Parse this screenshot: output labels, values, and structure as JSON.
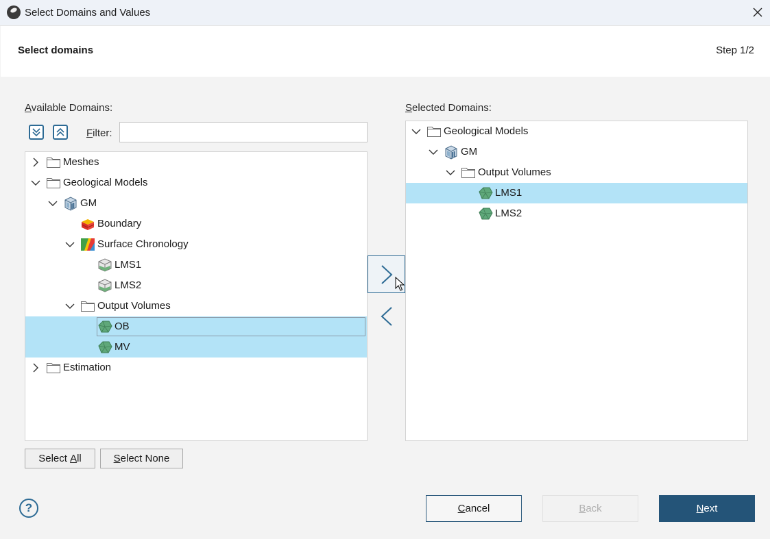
{
  "window": {
    "title": "Select Domains and Values"
  },
  "header": {
    "title": "Select domains",
    "step": "Step 1/2"
  },
  "available": {
    "label_prefix": "A",
    "label_rest": "vailable Domains:",
    "filter_label_prefix": "F",
    "filter_label_rest": "ilter:",
    "filter_value": "",
    "tree": [
      {
        "label": "Meshes",
        "depth": 0,
        "expander": "collapsed",
        "icon": "folder-icon",
        "selected": false
      },
      {
        "label": "Geological Models",
        "depth": 0,
        "expander": "expanded",
        "icon": "folder-icon",
        "selected": false
      },
      {
        "label": "GM",
        "depth": 1,
        "expander": "expanded",
        "icon": "geomodel-icon",
        "selected": false
      },
      {
        "label": "Boundary",
        "depth": 2,
        "expander": "none",
        "icon": "boundary-icon",
        "selected": false
      },
      {
        "label": "Surface Chronology",
        "depth": 2,
        "expander": "expanded",
        "icon": "chronology-icon",
        "selected": false
      },
      {
        "label": "LMS1",
        "depth": 3,
        "expander": "none",
        "icon": "surface-icon",
        "selected": false
      },
      {
        "label": "LMS2",
        "depth": 3,
        "expander": "none",
        "icon": "surface-icon",
        "selected": false
      },
      {
        "label": "Output Volumes",
        "depth": 2,
        "expander": "expanded",
        "icon": "folder-icon",
        "selected": false
      },
      {
        "label": "OB",
        "depth": 3,
        "expander": "none",
        "icon": "volume-icon",
        "selected": true,
        "focused": true
      },
      {
        "label": "MV",
        "depth": 3,
        "expander": "none",
        "icon": "volume-icon",
        "selected": true
      },
      {
        "label": "Estimation",
        "depth": 0,
        "expander": "collapsed",
        "icon": "folder-icon",
        "selected": false
      }
    ],
    "select_all_prefix": "Select ",
    "select_all_accel": "A",
    "select_all_rest": "ll",
    "select_none_accel": "S",
    "select_none_rest": "elect None"
  },
  "selected": {
    "label_prefix": "S",
    "label_rest": "elected Domains:",
    "tree": [
      {
        "label": "Geological Models",
        "depth": 0,
        "expander": "expanded",
        "icon": "folder-icon",
        "selected": false
      },
      {
        "label": "GM",
        "depth": 1,
        "expander": "expanded",
        "icon": "geomodel-icon",
        "selected": false
      },
      {
        "label": "Output Volumes",
        "depth": 2,
        "expander": "expanded",
        "icon": "folder-icon",
        "selected": false
      },
      {
        "label": "LMS1",
        "depth": 3,
        "expander": "none",
        "icon": "volume-icon",
        "selected": true
      },
      {
        "label": "LMS2",
        "depth": 3,
        "expander": "none",
        "icon": "volume-icon",
        "selected": false
      }
    ]
  },
  "footer": {
    "cancel_accel": "C",
    "cancel_rest": "ancel",
    "back_accel": "B",
    "back_rest": "ack",
    "next_accel": "N",
    "next_rest": "ext",
    "help": "?"
  },
  "colors": {
    "accent": "#245478",
    "selection": "#b3e3f7",
    "volume_green": "#5fa87a"
  }
}
